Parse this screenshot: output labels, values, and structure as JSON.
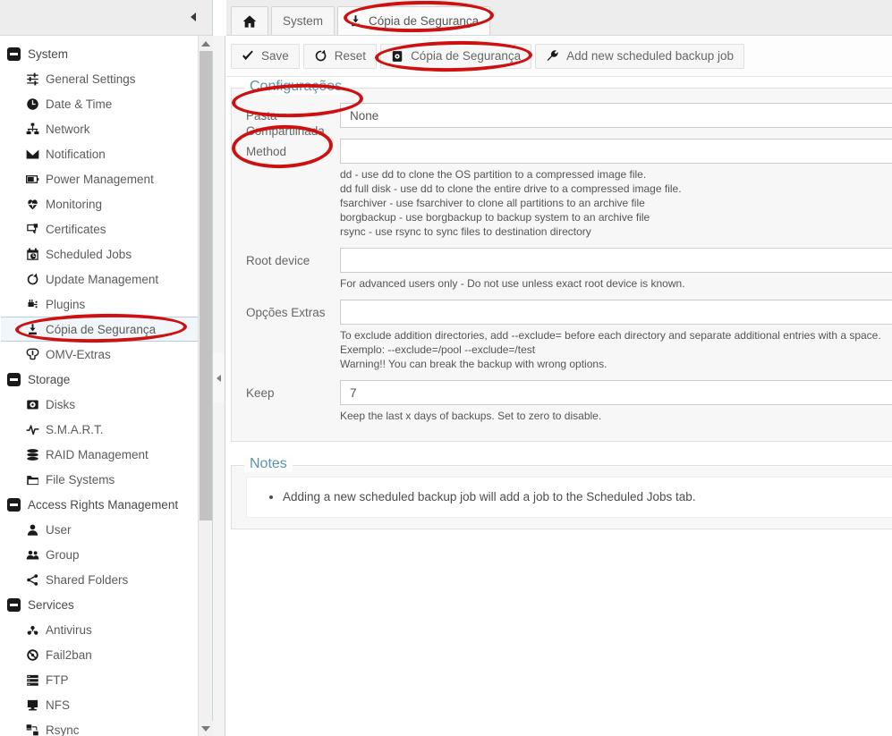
{
  "window": {
    "collapse_left_icon": "triangle-left-icon",
    "splitter_icon": "triangle-left-icon"
  },
  "sidebar": {
    "items": [
      {
        "label": "System",
        "icon": "collapse-minus-icon",
        "type": "group",
        "selected": false
      },
      {
        "label": "General Settings",
        "icon": "sliders-icon",
        "type": "child",
        "selected": false
      },
      {
        "label": "Date & Time",
        "icon": "clock-icon",
        "type": "child",
        "selected": false
      },
      {
        "label": "Network",
        "icon": "network-icon",
        "type": "child",
        "selected": false
      },
      {
        "label": "Notification",
        "icon": "envelope-icon",
        "type": "child",
        "selected": false
      },
      {
        "label": "Power Management",
        "icon": "battery-icon",
        "type": "child",
        "selected": false
      },
      {
        "label": "Monitoring",
        "icon": "heartbeat-icon",
        "type": "child",
        "selected": false
      },
      {
        "label": "Certificates",
        "icon": "certificate-icon",
        "type": "child",
        "selected": false
      },
      {
        "label": "Scheduled Jobs",
        "icon": "calendar-clock-icon",
        "type": "child",
        "selected": false
      },
      {
        "label": "Update Management",
        "icon": "refresh-icon",
        "type": "child",
        "selected": false
      },
      {
        "label": "Plugins",
        "icon": "plug-icon",
        "type": "child",
        "selected": false
      },
      {
        "label": "Cópia de Segurança",
        "icon": "download-stamp-icon",
        "type": "child",
        "selected": true
      },
      {
        "label": "OMV-Extras",
        "icon": "power-plug-icon",
        "type": "child",
        "selected": false
      },
      {
        "label": "Storage",
        "icon": "collapse-minus-icon",
        "type": "group",
        "selected": false
      },
      {
        "label": "Disks",
        "icon": "hard-disk-icon",
        "type": "child",
        "selected": false
      },
      {
        "label": "S.M.A.R.T.",
        "icon": "pulse-icon",
        "type": "child",
        "selected": false
      },
      {
        "label": "RAID Management",
        "icon": "stack-icon",
        "type": "child",
        "selected": false
      },
      {
        "label": "File Systems",
        "icon": "folder-icon",
        "type": "child",
        "selected": false
      },
      {
        "label": "Access Rights Management",
        "icon": "collapse-minus-icon",
        "type": "group",
        "selected": false
      },
      {
        "label": "User",
        "icon": "user-icon",
        "type": "child",
        "selected": false
      },
      {
        "label": "Group",
        "icon": "users-icon",
        "type": "child",
        "selected": false
      },
      {
        "label": "Shared Folders",
        "icon": "share-icon",
        "type": "child",
        "selected": false
      },
      {
        "label": "Services",
        "icon": "collapse-minus-icon",
        "type": "group",
        "selected": false
      },
      {
        "label": "Antivirus",
        "icon": "biohazard-icon",
        "type": "child",
        "selected": false
      },
      {
        "label": "Fail2ban",
        "icon": "ban-icon",
        "type": "child",
        "selected": false
      },
      {
        "label": "FTP",
        "icon": "server-icon",
        "type": "child",
        "selected": false
      },
      {
        "label": "NFS",
        "icon": "monitor-icon",
        "type": "child",
        "selected": false
      },
      {
        "label": "Rsync",
        "icon": "sync-computers-icon",
        "type": "child",
        "selected": false
      }
    ]
  },
  "tabs": [
    {
      "label": "",
      "icon": "home-icon",
      "active": false
    },
    {
      "label": "System",
      "icon": "",
      "active": false
    },
    {
      "label": "Cópia de Segurança",
      "icon": "download-stamp-icon",
      "active": true
    }
  ],
  "toolbar": {
    "buttons": [
      {
        "label": "Save",
        "icon": "check-icon"
      },
      {
        "label": "Reset",
        "icon": "refresh-icon"
      },
      {
        "label": "Cópia de Segurança",
        "icon": "backup-disk-icon"
      },
      {
        "label": "Add new scheduled backup job",
        "icon": "wrench-icon"
      }
    ]
  },
  "settings_panel": {
    "legend": "Configurações",
    "fields": [
      {
        "label": "Pasta Compartilhada",
        "value": "None",
        "hint": ""
      },
      {
        "label": "Method",
        "value": "",
        "hint": "dd - use dd to clone the OS partition to a compressed image file.\ndd full disk - use dd to clone the entire drive to a compressed image file.\nfsarchiver - use fsarchiver to clone all partitions to an archive file\nborgbackup - use borgbackup to backup system to an archive file\nrsync - use rsync to sync files to destination directory"
      },
      {
        "label": "Root device",
        "value": "",
        "hint": "For advanced users only - Do not use unless exact root device is known."
      },
      {
        "label": "Opções Extras",
        "value": "",
        "hint": "To exclude addition directories, add --exclude= before each directory and separate additional entries with a space.\nExemplo: --exclude=/pool --exclude=/test\nWarning!! You can break the backup with wrong options."
      },
      {
        "label": "Keep",
        "value": "7",
        "hint": "Keep the last x days of backups. Set to zero to disable."
      }
    ]
  },
  "notes_panel": {
    "legend": "Notes",
    "items": [
      "Adding a new scheduled backup job will add a job to the Scheduled Jobs tab."
    ]
  },
  "colors": {
    "annotation": "#cf1010",
    "legend": "#5c93ad",
    "selected_border": "#b3d0e0",
    "header_bg": "#ededed"
  }
}
